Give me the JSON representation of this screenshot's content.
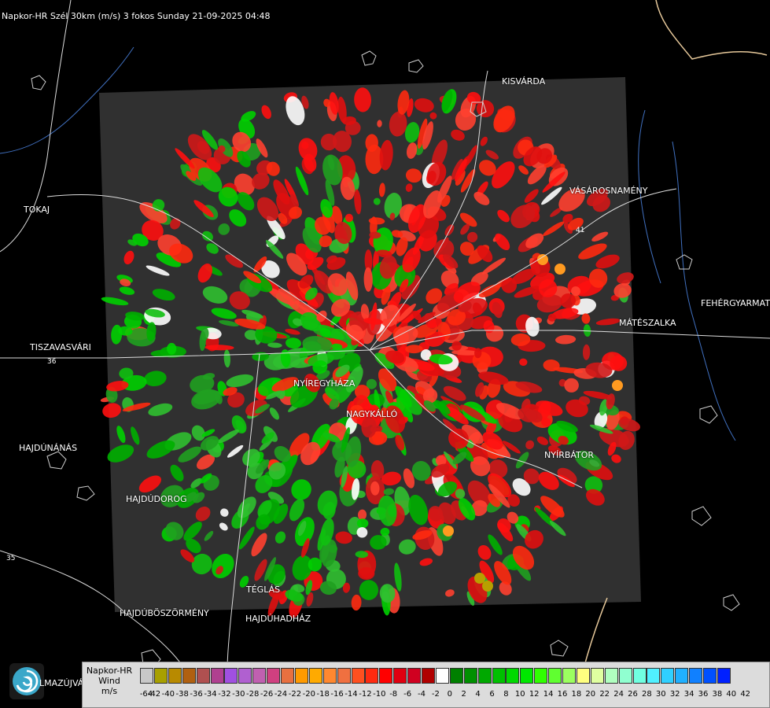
{
  "title": "Napkor-HR Szél 30km (m/s) 3 fokos Sunday 21-09-2025 04:48",
  "cities": [
    {
      "name": "KISVÁRDA"
    },
    {
      "name": "VÁSÁROSNAMÉNY"
    },
    {
      "name": "TOKAJ"
    },
    {
      "name": "FEHÉRGYARMAT"
    },
    {
      "name": "MÁTÉSZALKA"
    },
    {
      "name": "TISZAVASVÁRI"
    },
    {
      "name": "NYÍREGYHÁZA"
    },
    {
      "name": "NAGYKÁLLÓ"
    },
    {
      "name": "HAJDÚNÁNÁS"
    },
    {
      "name": "NYÍRBÁTOR"
    },
    {
      "name": "HAJDÚDOROG"
    },
    {
      "name": "TÉGLÁS"
    },
    {
      "name": "HAJDÚBÖSZÖRMÉNY"
    },
    {
      "name": "HAJDÚHADHÁZ"
    }
  ],
  "road_numbers": [
    "36",
    "41",
    "35"
  ],
  "logo_text": "LMAZÚJVÁR",
  "legend": {
    "title_lines": [
      "Napkor-HR",
      "Wind",
      "m/s"
    ],
    "labels": [
      "-64",
      "-42",
      "-40",
      "-38",
      "-36",
      "-34",
      "-32",
      "-30",
      "-28",
      "-26",
      "-24",
      "-22",
      "-20",
      "-18",
      "-16",
      "-14",
      "-12",
      "-10",
      "-8",
      "-6",
      "-4",
      "-2",
      "0",
      "2",
      "4",
      "6",
      "8",
      "10",
      "12",
      "14",
      "16",
      "18",
      "20",
      "22",
      "24",
      "26",
      "28",
      "30",
      "32",
      "34",
      "36",
      "38",
      "40",
      "42"
    ],
    "colors": [
      "#c8c8c8",
      "#a8a000",
      "#b88a00",
      "#b06010",
      "#b05050",
      "#b04090",
      "#a050e0",
      "#b060d0",
      "#c060b0",
      "#d04080",
      "#e87040",
      "#ff9a00",
      "#ffaa00",
      "#ff8830",
      "#f07040",
      "#ff5020",
      "#ff2a10",
      "#ff0000",
      "#e00010",
      "#d00020",
      "#b00000",
      "#ffffff",
      "#008000",
      "#009000",
      "#00a800",
      "#00c000",
      "#00d800",
      "#00e800",
      "#30ff00",
      "#60ff30",
      "#9cff60",
      "#ffff80",
      "#e0ffa0",
      "#b0ffc0",
      "#90ffd0",
      "#70ffe0",
      "#50f0ff",
      "#30d0ff",
      "#20b0ff",
      "#1080ff",
      "#0050ff",
      "#0020ff"
    ]
  }
}
